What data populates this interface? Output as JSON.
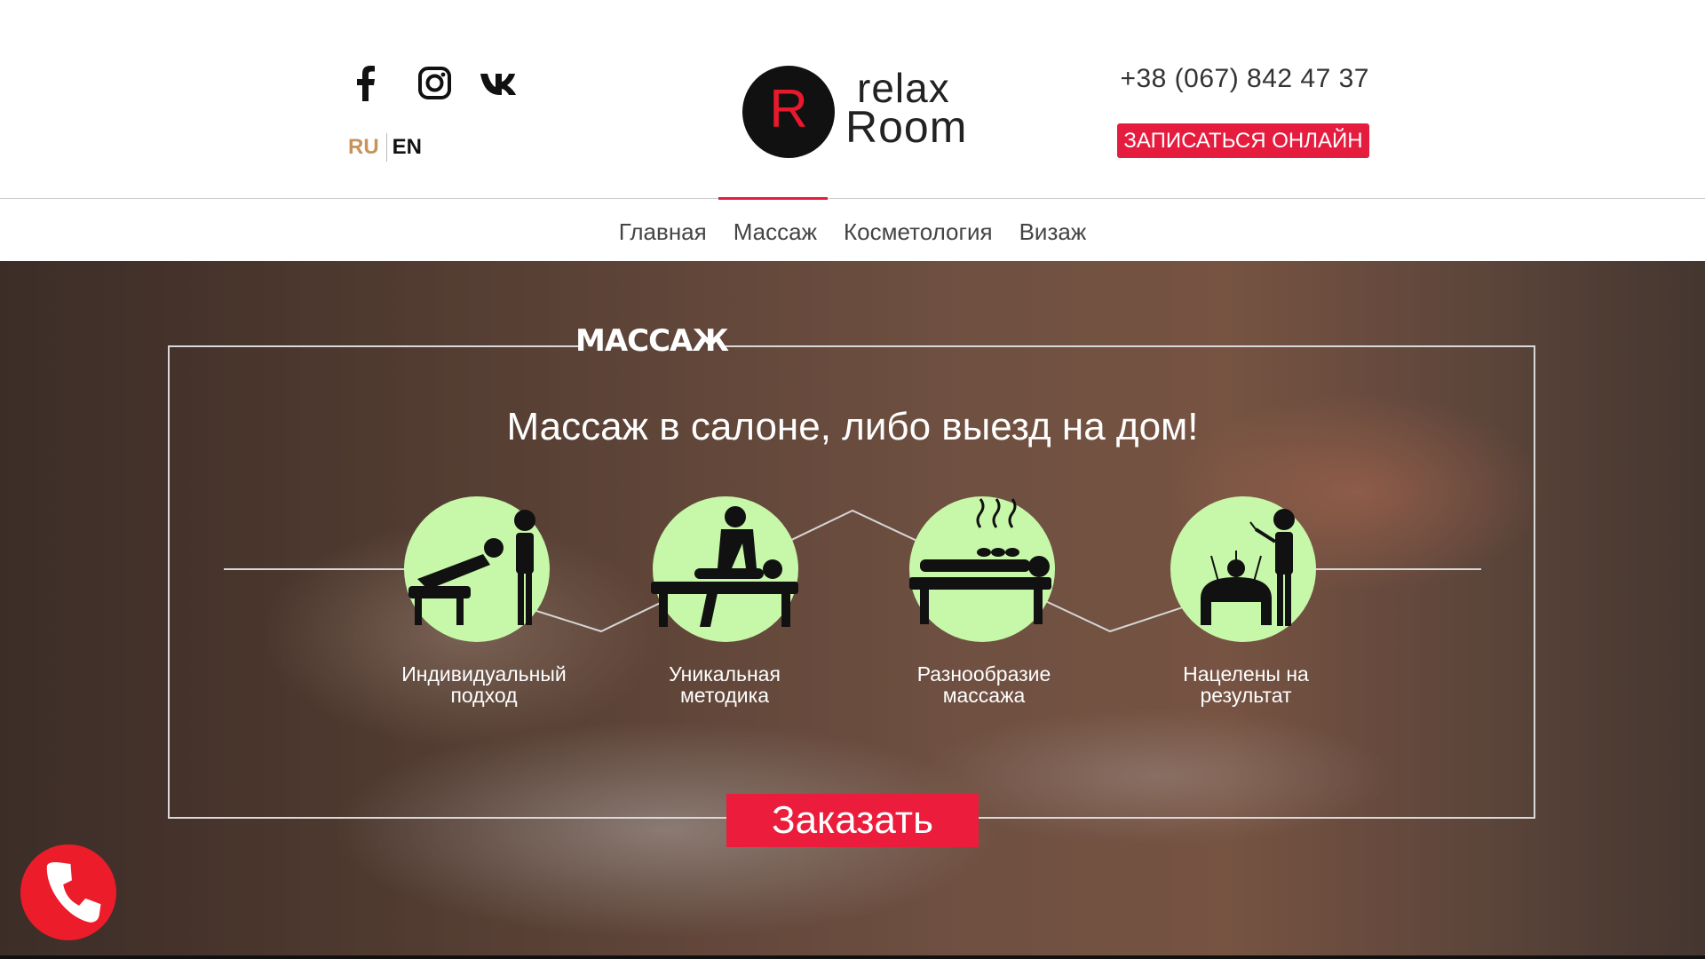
{
  "header": {
    "social": [
      {
        "name": "facebook-icon"
      },
      {
        "name": "instagram-icon"
      },
      {
        "name": "vk-icon"
      }
    ],
    "lang": {
      "ru": "RU",
      "en": "EN",
      "active": "RU"
    },
    "logo": {
      "letter": "R",
      "word1": "relax",
      "word2": "Room"
    },
    "phone": "+38 (067) 842 47 37",
    "signup_label": "ЗАПИСАТЬСЯ ОНЛАЙН"
  },
  "nav": {
    "items": [
      "Главная",
      "Массаж",
      "Косметология",
      "Визаж"
    ],
    "active": "Массаж"
  },
  "hero": {
    "section_title": "МАССАЖ",
    "subtitle": "Массаж в салоне, либо выезд на дом!",
    "features": [
      {
        "line1": "Индивидуальный",
        "line2": "подход",
        "icon": "leaning-massage-icon"
      },
      {
        "line1": "Уникальная",
        "line2": "методика",
        "icon": "back-massage-icon"
      },
      {
        "line1": "Разнообразие",
        "line2": "массажа",
        "icon": "hot-stone-massage-icon"
      },
      {
        "line1": "Нацелены на",
        "line2": "результат",
        "icon": "acupuncture-icon"
      }
    ],
    "order_label": "Заказать"
  },
  "colors": {
    "accent": "#e61c3f",
    "lang_active": "#c8935b",
    "icon_circle": "#c7f7a8"
  }
}
